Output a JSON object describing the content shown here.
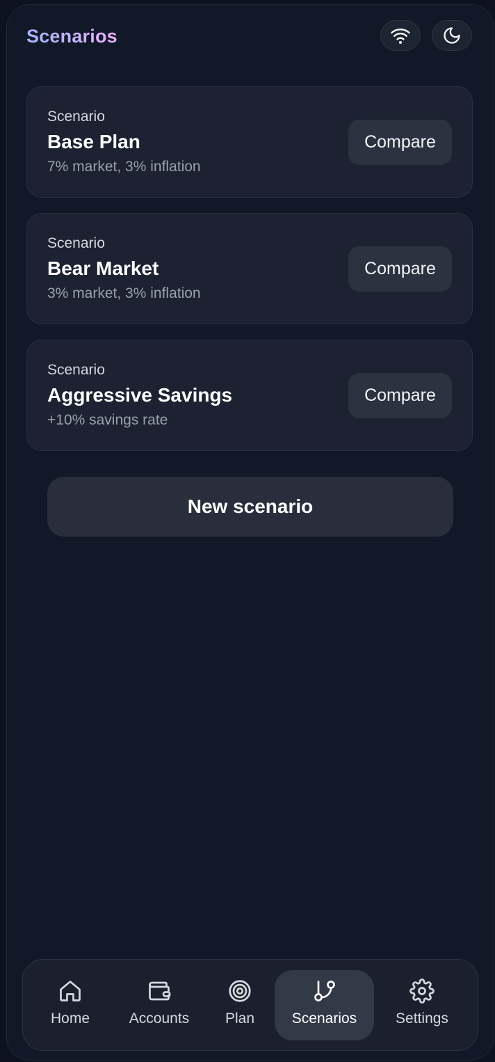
{
  "header": {
    "title": "Scenarios",
    "wifi_icon": "wifi-icon",
    "theme_icon": "moon-icon"
  },
  "scenarios": [
    {
      "label": "Scenario",
      "name": "Base Plan",
      "description": "7% market, 3% inflation",
      "action": "Compare"
    },
    {
      "label": "Scenario",
      "name": "Bear Market",
      "description": "3% market, 3% inflation",
      "action": "Compare"
    },
    {
      "label": "Scenario",
      "name": "Aggressive Savings",
      "description": "+10% savings rate",
      "action": "Compare"
    }
  ],
  "new_scenario_label": "New scenario",
  "nav": {
    "items": [
      {
        "label": "Home",
        "icon": "home-icon"
      },
      {
        "label": "Accounts",
        "icon": "wallet-icon"
      },
      {
        "label": "Plan",
        "icon": "target-icon"
      },
      {
        "label": "Scenarios",
        "icon": "git-branch-icon"
      },
      {
        "label": "Settings",
        "icon": "gear-icon"
      }
    ],
    "active": "Scenarios"
  },
  "colors": {
    "background": "#111827",
    "card": "#1c2231",
    "button": "#2b3240",
    "title_gradient": [
      "#a5b4fc",
      "#f0abfc"
    ]
  }
}
